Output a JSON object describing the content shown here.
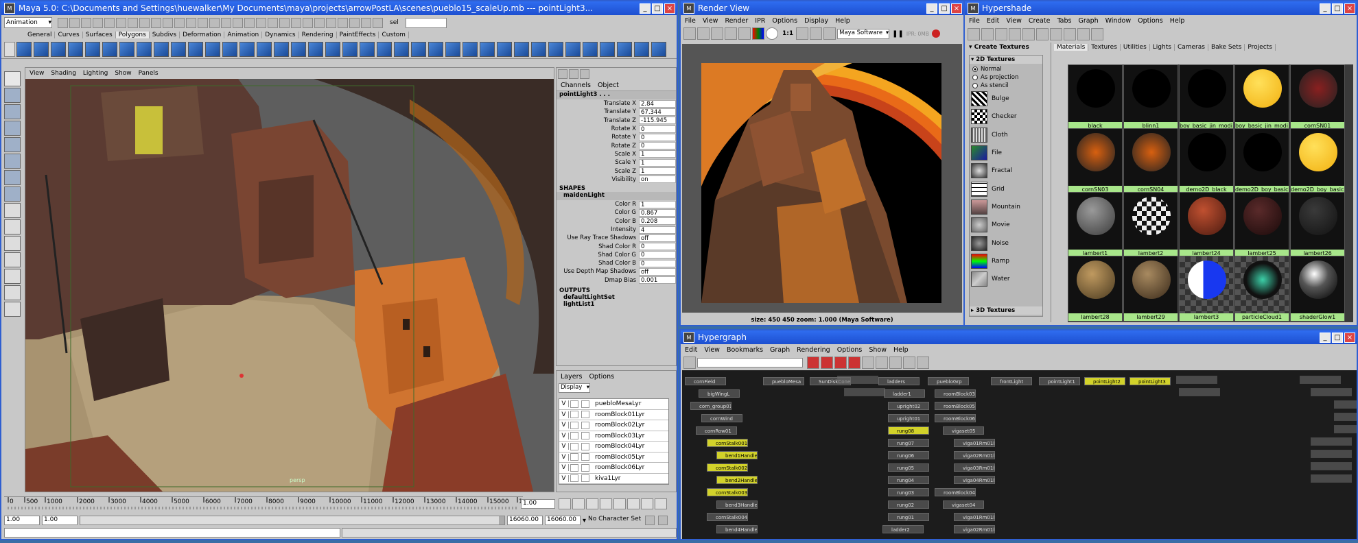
{
  "maya": {
    "title": "Maya 5.0: C:\\Documents and Settings\\huewalker\\My Documents\\maya\\projects\\arrowPostLA\\scenes\\pueblo15_scaleUp.mb  ---  pointLight3...",
    "mode": "Animation",
    "sel_field": "sel",
    "shelf_tabs": [
      "General",
      "Curves",
      "Surfaces",
      "Polygons",
      "Subdivs",
      "Deformation",
      "Animation",
      "Dynamics",
      "Rendering",
      "PaintEffects",
      "Custom"
    ],
    "active_shelf": "Polygons",
    "viewport_menu": [
      "View",
      "Shading",
      "Lighting",
      "Show",
      "Panels"
    ],
    "viewport_cam_label": "persp",
    "channels_tabs": [
      "Channels",
      "Object"
    ],
    "node_name": "pointLight3 . . .",
    "channels": [
      {
        "label": "Translate X",
        "value": "2.84"
      },
      {
        "label": "Translate Y",
        "value": "67.344"
      },
      {
        "label": "Translate Z",
        "value": "-115.945"
      },
      {
        "label": "Rotate X",
        "value": "0"
      },
      {
        "label": "Rotate Y",
        "value": "0"
      },
      {
        "label": "Rotate Z",
        "value": "0"
      },
      {
        "label": "Scale X",
        "value": "1"
      },
      {
        "label": "Scale Y",
        "value": "1"
      },
      {
        "label": "Scale Z",
        "value": "1"
      },
      {
        "label": "Visibility",
        "value": "on"
      }
    ],
    "shapes_header": "SHAPES",
    "shape_name": "maidenLight",
    "shape_channels": [
      {
        "label": "Color R",
        "value": "1"
      },
      {
        "label": "Color G",
        "value": "0.867"
      },
      {
        "label": "Color B",
        "value": "0.208"
      },
      {
        "label": "Intensity",
        "value": "4"
      },
      {
        "label": "Use Ray Trace Shadows",
        "value": "off"
      },
      {
        "label": "Shad Color R",
        "value": "0"
      },
      {
        "label": "Shad Color G",
        "value": "0"
      },
      {
        "label": "Shad Color B",
        "value": "0"
      },
      {
        "label": "Use Depth Map Shadows",
        "value": "off"
      },
      {
        "label": "Dmap Bias",
        "value": "0.001"
      }
    ],
    "outputs_header": "OUTPUTS",
    "outputs": [
      "defaultLightSet",
      "lightList1"
    ],
    "layers_menu": [
      "Layers",
      "Options"
    ],
    "layers_display": "Display",
    "layers": [
      {
        "v": "V",
        "name": "puebloMesaLyr"
      },
      {
        "v": "V",
        "name": "roomBlock01Lyr"
      },
      {
        "v": "V",
        "name": "roomBlock02Lyr"
      },
      {
        "v": "V",
        "name": "roomBlock03Lyr"
      },
      {
        "v": "V",
        "name": "roomBlock04Lyr"
      },
      {
        "v": "V",
        "name": "roomBlock05Lyr"
      },
      {
        "v": "V",
        "name": "roomBlock06Lyr"
      },
      {
        "v": "V",
        "name": "kiva1Lyr"
      }
    ],
    "timeline_ticks": [
      "0",
      "500",
      "1000",
      "2000",
      "3000",
      "4000",
      "5000",
      "6000",
      "7000",
      "8000",
      "9000",
      "10000",
      "11000",
      "12000",
      "13000",
      "14000",
      "15000",
      "1"
    ],
    "current_frame": "1.00",
    "range_start": "1.00",
    "range_start2": "1.00",
    "range_end": "16060.00",
    "range_end2": "16060.00",
    "character_set": "No Character Set"
  },
  "render_view": {
    "title": "Render View",
    "menu": [
      "File",
      "View",
      "Render",
      "IPR",
      "Options",
      "Display",
      "Help"
    ],
    "renderer": "Maya Software",
    "ratio": "1:1",
    "ipr_label": "IPR: 0MB",
    "status": "size:  450  450 zoom: 1.000  (Maya Software)"
  },
  "hypershade": {
    "title": "Hypershade",
    "menu": [
      "File",
      "Edit",
      "View",
      "Create",
      "Tabs",
      "Graph",
      "Window",
      "Options",
      "Help"
    ],
    "create_header": "Create Textures",
    "section_2d": "2D Textures",
    "radio": [
      {
        "label": "Normal",
        "checked": true
      },
      {
        "label": "As projection",
        "checked": false
      },
      {
        "label": "As stencil",
        "checked": false
      }
    ],
    "textures": [
      "Bulge",
      "Checker",
      "Cloth",
      "File",
      "Fractal",
      "Grid",
      "Mountain",
      "Movie",
      "Noise",
      "Ramp",
      "Water"
    ],
    "section_3d": "3D Textures",
    "tabs": [
      "Materials",
      "Textures",
      "Utilities",
      "Lights",
      "Cameras",
      "Bake Sets",
      "Projects"
    ],
    "active_tab": "Materials",
    "materials": [
      {
        "name": "black",
        "swatch": "black"
      },
      {
        "name": "blinn1",
        "swatch": "black"
      },
      {
        "name": "boy_basic_jin_modi...",
        "swatch": "black"
      },
      {
        "name": "boy_basic_jin_modi...",
        "swatch": "yellow"
      },
      {
        "name": "cornSN01",
        "swatch": "corn-red"
      },
      {
        "name": "cornSN03",
        "swatch": "corn-orange"
      },
      {
        "name": "cornSN04",
        "swatch": "corn-orange"
      },
      {
        "name": "demo2D_black",
        "swatch": "black"
      },
      {
        "name": "demo2D_boy_basic...",
        "swatch": "black"
      },
      {
        "name": "demo2D_boy_basic...",
        "swatch": "yellow"
      },
      {
        "name": "lambert1",
        "swatch": "grey"
      },
      {
        "name": "lambert2",
        "swatch": "checker"
      },
      {
        "name": "lambert24",
        "swatch": "rust"
      },
      {
        "name": "lambert25",
        "swatch": "maroon"
      },
      {
        "name": "lambert26",
        "swatch": "dark"
      },
      {
        "name": "lambert28",
        "swatch": "tan"
      },
      {
        "name": "lambert29",
        "swatch": "tan2"
      },
      {
        "name": "lambert3",
        "swatch": "blue-checker"
      },
      {
        "name": "particleCloud1",
        "swatch": "cloud"
      },
      {
        "name": "shaderGlow1",
        "swatch": "glow"
      }
    ]
  },
  "hypergraph": {
    "title": "Hypergraph",
    "menu": [
      "Edit",
      "View",
      "Bookmarks",
      "Graph",
      "Rendering",
      "Options",
      "Show",
      "Help"
    ],
    "nodes": [
      {
        "label": "cornField",
        "c": "n"
      },
      {
        "label": "bigWingL",
        "c": "n"
      },
      {
        "label": "corn_group01",
        "c": "n"
      },
      {
        "label": "cornWind",
        "c": "n"
      },
      {
        "label": "cornRow01",
        "c": "n"
      },
      {
        "label": "cornStalk001",
        "c": "y"
      },
      {
        "label": "bend1Handle",
        "c": "y"
      },
      {
        "label": "cornStalk002",
        "c": "y"
      },
      {
        "label": "bend2Handle",
        "c": "y"
      },
      {
        "label": "cornStalk003",
        "c": "y"
      },
      {
        "label": "bend3Handle",
        "c": "n"
      },
      {
        "label": "cornStalk004",
        "c": "n"
      },
      {
        "label": "bend4Handle",
        "c": "n"
      },
      {
        "label": "puebloMesa",
        "c": "n"
      },
      {
        "label": "SunDiskCone",
        "c": "n"
      },
      {
        "label": "ladders",
        "c": "n"
      },
      {
        "label": "ladder1",
        "c": "n"
      },
      {
        "label": "upright02",
        "c": "n"
      },
      {
        "label": "upright01",
        "c": "n"
      },
      {
        "label": "rung08",
        "c": "y"
      },
      {
        "label": "rung07",
        "c": "n"
      },
      {
        "label": "rung06",
        "c": "n"
      },
      {
        "label": "rung05",
        "c": "n"
      },
      {
        "label": "rung04",
        "c": "n"
      },
      {
        "label": "rung03",
        "c": "n"
      },
      {
        "label": "rung02",
        "c": "n"
      },
      {
        "label": "rung01",
        "c": "n"
      },
      {
        "label": "ladder2",
        "c": "n"
      },
      {
        "label": "puebloGrp",
        "c": "n"
      },
      {
        "label": "roomBlock03",
        "c": "n"
      },
      {
        "label": "roomBlock05",
        "c": "n"
      },
      {
        "label": "roomBlock06",
        "c": "n"
      },
      {
        "label": "vigaset05",
        "c": "n"
      },
      {
        "label": "viga01Rm01b",
        "c": "n"
      },
      {
        "label": "viga02Rm01b",
        "c": "n"
      },
      {
        "label": "viga03Rm01b",
        "c": "n"
      },
      {
        "label": "viga04Rm01b",
        "c": "n"
      },
      {
        "label": "roomBlock04",
        "c": "n"
      },
      {
        "label": "vigaset04",
        "c": "n"
      },
      {
        "label": "viga01Rm01b",
        "c": "n"
      },
      {
        "label": "viga02Rm01b",
        "c": "n"
      },
      {
        "label": "frontLight",
        "c": "n"
      },
      {
        "label": "pointLight1",
        "c": "n"
      },
      {
        "label": "pointLight2",
        "c": "y"
      },
      {
        "label": "pointLight3",
        "c": "y"
      }
    ]
  }
}
